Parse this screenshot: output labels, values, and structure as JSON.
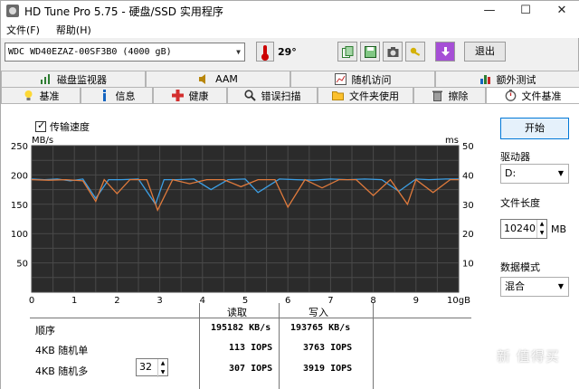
{
  "window": {
    "title": "HD Tune Pro 5.75 - 硬盘/SSD 实用程序",
    "controls": {
      "minimize": "—",
      "maximize": "☐",
      "close": "✕"
    }
  },
  "menu": [
    {
      "label": "文件(F)"
    },
    {
      "label": "帮助(H)"
    }
  ],
  "toolbar": {
    "drive": "WDC WD40EZAZ-00SF3B0 (4000 gB)",
    "temperature": "29°",
    "exit_label": "退出",
    "buttons": [
      "copy-icon",
      "save-icon",
      "camera-icon",
      "key-icon",
      "download-icon"
    ]
  },
  "tabs_row1": [
    "磁盘监视器",
    "AAM",
    "随机访问",
    "额外测试"
  ],
  "tabs_row2": [
    "基准",
    "信息",
    "健康",
    "错误扫描",
    "文件夹使用",
    "擦除",
    "文件基准"
  ],
  "active_tab": "文件基准",
  "checkbox": {
    "label": "传输速度",
    "checked": true
  },
  "right_panel": {
    "start_label": "开始",
    "drive_label": "驱动器",
    "drive_value": "D:",
    "file_length_label": "文件长度",
    "file_length_value": "10240",
    "file_length_unit": "MB",
    "data_mode_label": "数据模式",
    "data_mode_value": "混合"
  },
  "results": {
    "col_read": "读取",
    "col_write": "写入",
    "rows": [
      {
        "label": "顺序",
        "read": "195182 KB/s",
        "write": "193765 KB/s"
      },
      {
        "label": "4KB 随机单",
        "read": "113 IOPS",
        "write": "3763 IOPS"
      },
      {
        "label": "4KB 随机多",
        "read": "307 IOPS",
        "write": "3919 IOPS"
      }
    ],
    "queue_depth": "32"
  },
  "watermark": "新 值得买",
  "chart_data": {
    "type": "line",
    "left_axis_label": "MB/s",
    "right_axis_label": "ms",
    "left_ticks": [
      "250",
      "200",
      "150",
      "100",
      "50"
    ],
    "right_ticks": [
      "50",
      "40",
      "30",
      "20",
      "10"
    ],
    "x_ticks": [
      "0",
      "1",
      "2",
      "3",
      "4",
      "5",
      "6",
      "7",
      "8",
      "9",
      "10gB"
    ],
    "ylim": [
      0,
      250
    ],
    "xlim": [
      0,
      10
    ],
    "series": [
      {
        "color": "#3ca0e6",
        "x": [
          0,
          0.3,
          0.6,
          0.9,
          1.2,
          1.5,
          1.8,
          2.1,
          2.5,
          2.9,
          3.1,
          3.4,
          3.8,
          4.2,
          4.6,
          5.0,
          5.3,
          5.8,
          6.2,
          6.6,
          7.0,
          7.4,
          7.8,
          8.2,
          8.6,
          9.0,
          9.3,
          9.7,
          10
        ],
        "y": [
          193,
          192,
          193,
          190,
          193,
          160,
          192,
          192,
          193,
          150,
          192,
          192,
          193,
          175,
          192,
          193,
          170,
          193,
          192,
          191,
          193,
          192,
          193,
          192,
          172,
          193,
          192,
          193,
          193
        ]
      },
      {
        "color": "#e07a3c",
        "x": [
          0,
          0.4,
          0.8,
          1.2,
          1.5,
          1.7,
          2.0,
          2.3,
          2.7,
          2.95,
          3.3,
          3.7,
          4.1,
          4.5,
          4.9,
          5.3,
          5.7,
          6.0,
          6.4,
          6.8,
          7.2,
          7.6,
          8.0,
          8.4,
          8.8,
          9.0,
          9.4,
          9.8,
          10
        ],
        "y": [
          192,
          191,
          192,
          190,
          155,
          192,
          168,
          192,
          192,
          140,
          192,
          185,
          192,
          192,
          180,
          192,
          192,
          145,
          192,
          178,
          192,
          192,
          165,
          192,
          150,
          192,
          170,
          192,
          192
        ]
      }
    ]
  }
}
